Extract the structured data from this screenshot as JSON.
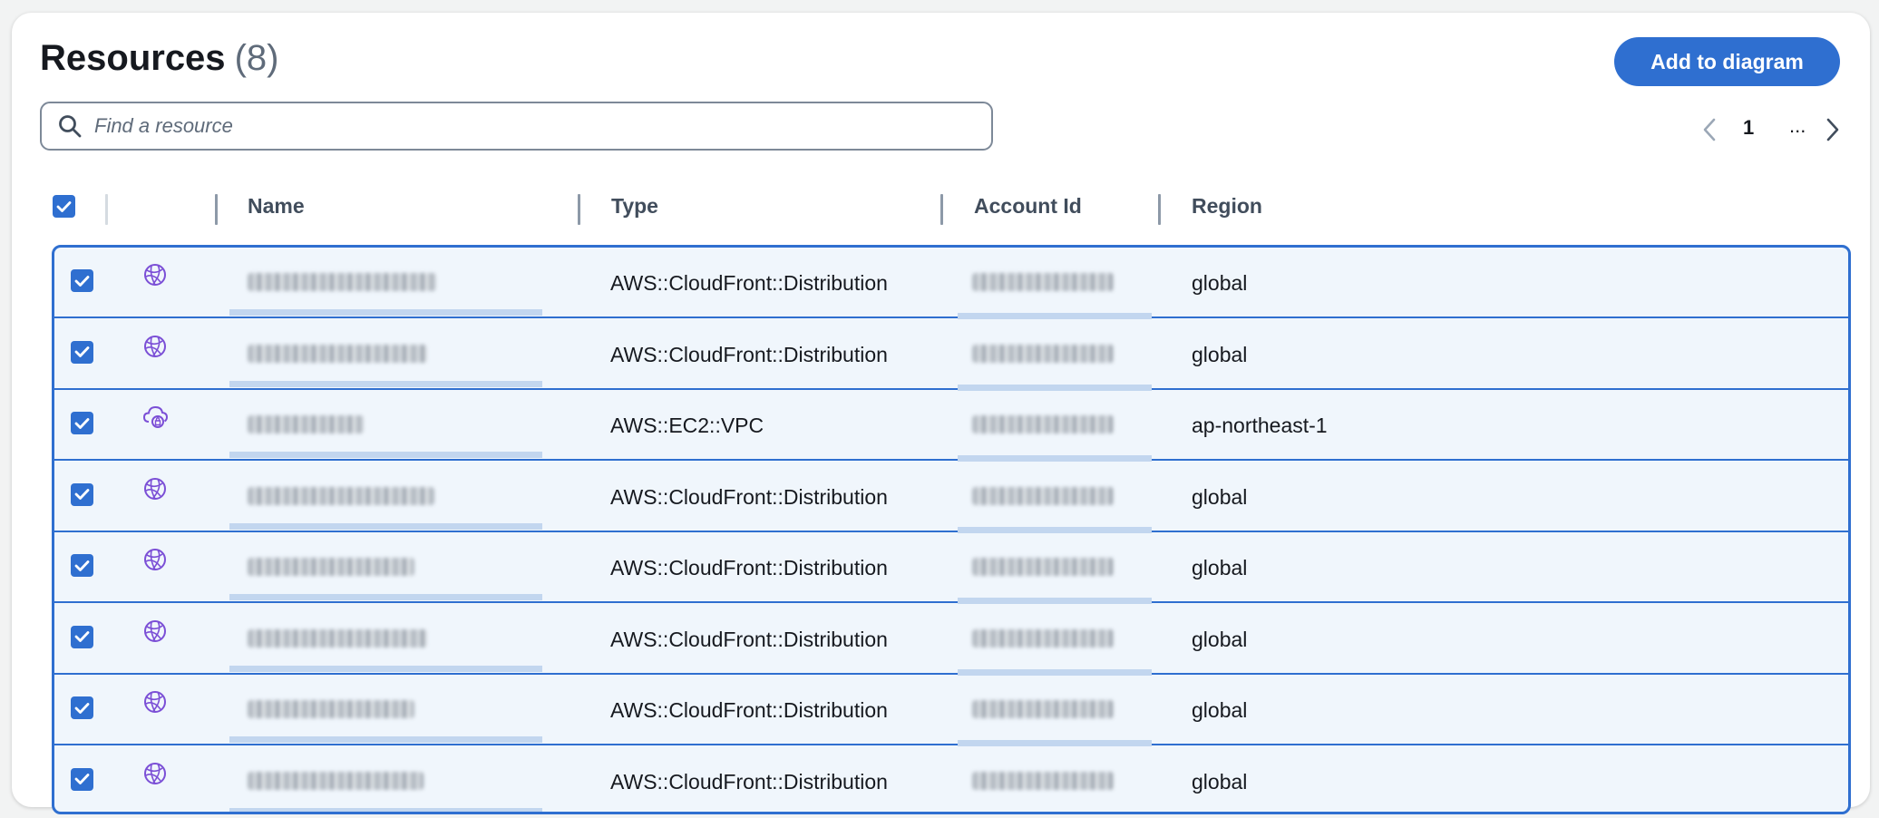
{
  "panel": {
    "title": "Resources",
    "count": "(8)",
    "add_button_label": "Add to diagram",
    "search": {
      "placeholder": "Find a resource",
      "value": ""
    },
    "pagination": {
      "current_page": "1",
      "ellipsis": "..."
    }
  },
  "colors": {
    "accent": "#2f6fd0",
    "row_bg": "#f0f6fc",
    "resource_icon": "#7b4fd6"
  },
  "table": {
    "columns": [
      "Name",
      "Type",
      "Account Id",
      "Region"
    ],
    "select_all_checked": true,
    "rows": [
      {
        "checked": true,
        "icon": "cloudfront-globe-icon",
        "name": "",
        "type": "AWS::CloudFront::Distribution",
        "account_id": "",
        "region": "global"
      },
      {
        "checked": true,
        "icon": "cloudfront-globe-icon",
        "name": "",
        "type": "AWS::CloudFront::Distribution",
        "account_id": "",
        "region": "global"
      },
      {
        "checked": true,
        "icon": "vpc-cloud-icon",
        "name": "",
        "type": "AWS::EC2::VPC",
        "account_id": "",
        "region": "ap-northeast-1"
      },
      {
        "checked": true,
        "icon": "cloudfront-globe-icon",
        "name": "",
        "type": "AWS::CloudFront::Distribution",
        "account_id": "",
        "region": "global"
      },
      {
        "checked": true,
        "icon": "cloudfront-globe-icon",
        "name": "",
        "type": "AWS::CloudFront::Distribution",
        "account_id": "",
        "region": "global"
      },
      {
        "checked": true,
        "icon": "cloudfront-globe-icon",
        "name": "",
        "type": "AWS::CloudFront::Distribution",
        "account_id": "",
        "region": "global"
      },
      {
        "checked": true,
        "icon": "cloudfront-globe-icon",
        "name": "",
        "type": "AWS::CloudFront::Distribution",
        "account_id": "",
        "region": "global"
      },
      {
        "checked": true,
        "icon": "cloudfront-globe-icon",
        "name": "",
        "type": "AWS::CloudFront::Distribution",
        "account_id": "",
        "region": "global"
      }
    ]
  }
}
